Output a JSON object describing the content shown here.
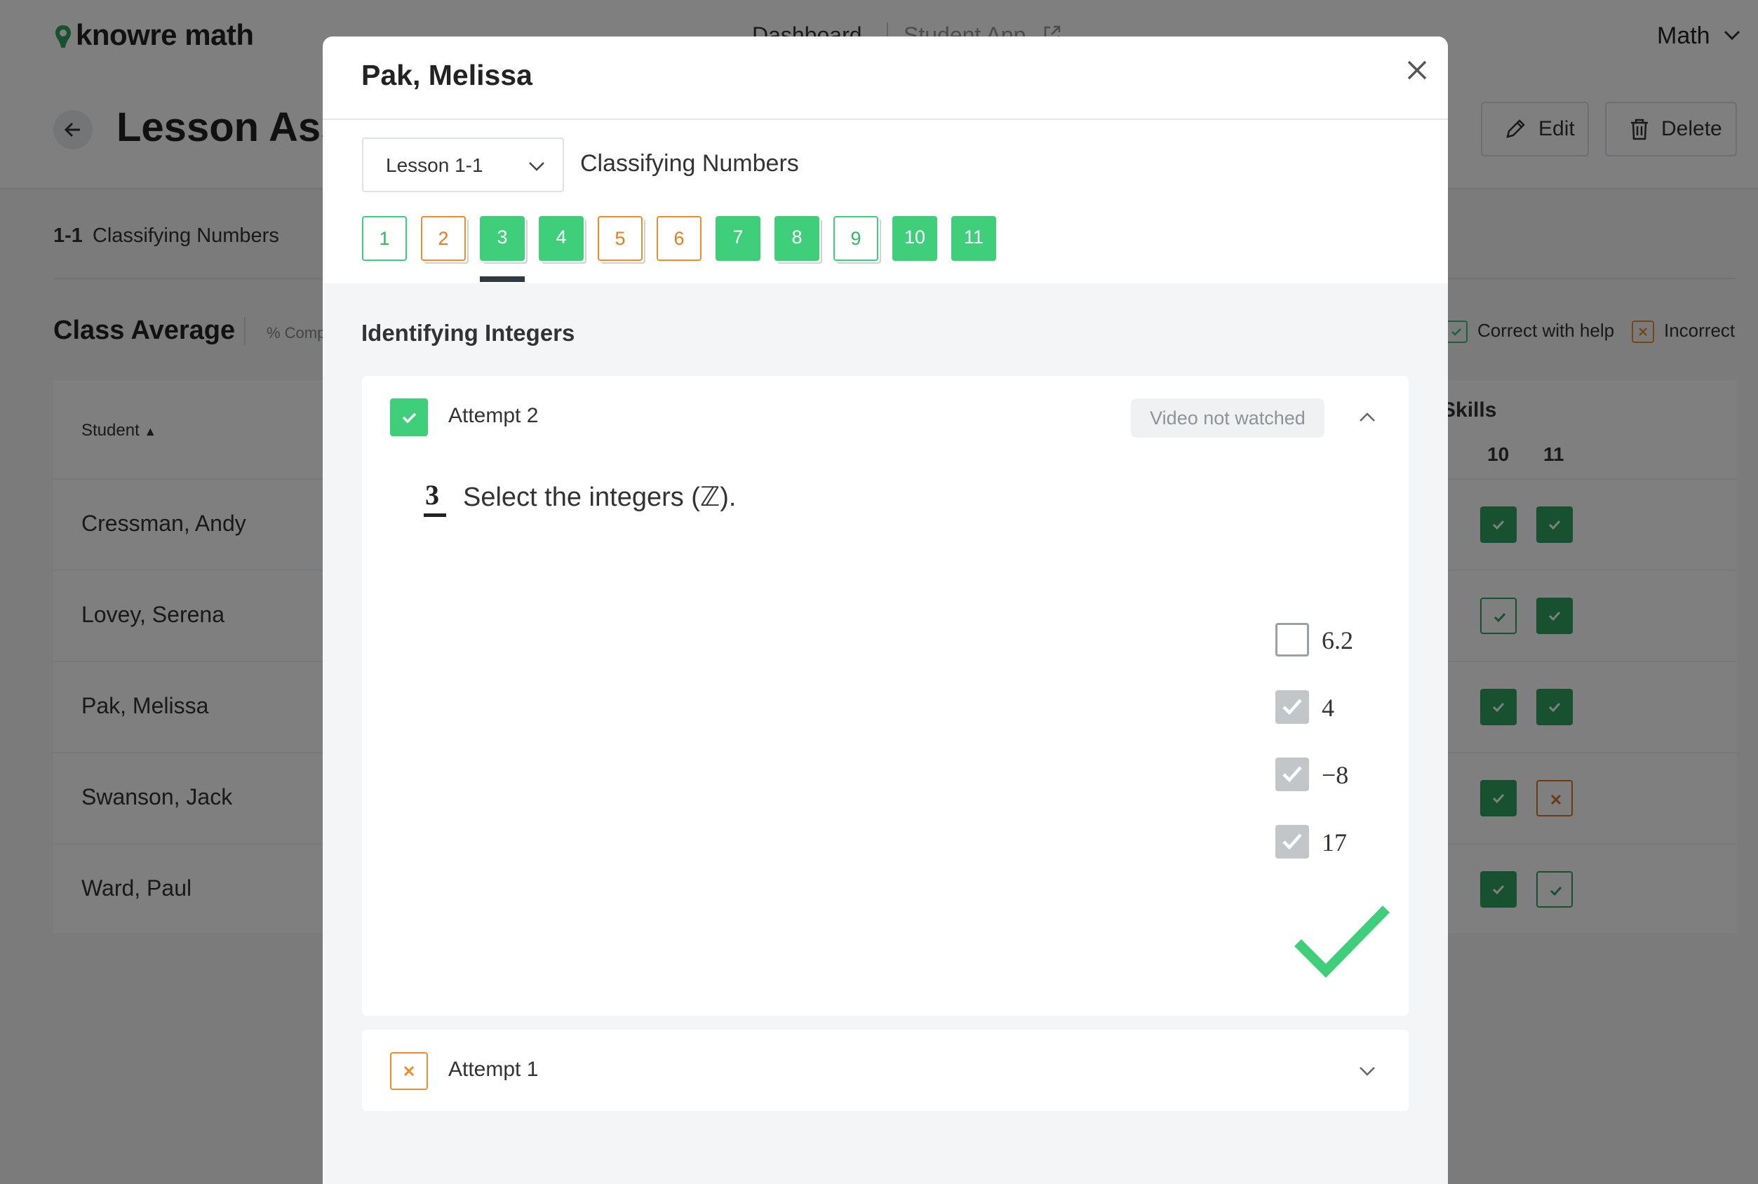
{
  "app": {
    "logo_text": "knowre math",
    "nav_dashboard": "Dashboard",
    "nav_student_app": "Student App",
    "subject": "Math"
  },
  "page": {
    "title": "Lesson Assignment",
    "edit_label": "Edit",
    "delete_label": "Delete",
    "lesson_code": "1-1",
    "lesson_name": "Classifying Numbers",
    "class_average_label": "Class Average",
    "class_average_sub": "% Complete",
    "legend_help": "Correct with help",
    "legend_incorrect": "Incorrect"
  },
  "table": {
    "student_header": "Student",
    "skills_header": "Skills",
    "col_10": "10",
    "col_11": "11",
    "rows": [
      {
        "name": "Cressman, Andy",
        "c10": "correct",
        "c11": "correct"
      },
      {
        "name": "Lovey, Serena",
        "c10": "correct-with-help",
        "c11": "correct"
      },
      {
        "name": "Pak, Melissa",
        "c10": "correct",
        "c11": "correct"
      },
      {
        "name": "Swanson, Jack",
        "c10": "correct",
        "c11": "incorrect"
      },
      {
        "name": "Ward, Paul",
        "c10": "correct",
        "c11": "correct-with-help"
      }
    ]
  },
  "modal": {
    "student_name": "Pak, Melissa",
    "lesson_select": "Lesson 1-1",
    "lesson_title": "Classifying Numbers",
    "questions": [
      {
        "label": "1",
        "status": "correct-with-help",
        "multiple": false
      },
      {
        "label": "2",
        "status": "incorrect",
        "multiple": true
      },
      {
        "label": "3",
        "status": "correct",
        "multiple": true,
        "active": true
      },
      {
        "label": "4",
        "status": "correct",
        "multiple": true
      },
      {
        "label": "5",
        "status": "incorrect",
        "multiple": true
      },
      {
        "label": "6",
        "status": "incorrect",
        "multiple": false
      },
      {
        "label": "7",
        "status": "correct",
        "multiple": false
      },
      {
        "label": "8",
        "status": "correct",
        "multiple": true
      },
      {
        "label": "9",
        "status": "correct-with-help",
        "multiple": true
      },
      {
        "label": "10",
        "status": "correct",
        "multiple": false
      },
      {
        "label": "11",
        "status": "correct",
        "multiple": false
      }
    ],
    "skill_title": "Identifying Integers",
    "attempt2": {
      "label": "Attempt 2",
      "status": "correct",
      "video_status": "Video not watched",
      "question_number": "3",
      "question_text": "Select the integers (ℤ).",
      "options": [
        {
          "value": "6.2",
          "checked": false
        },
        {
          "value": "4",
          "checked": true
        },
        {
          "value": "−8",
          "checked": true
        },
        {
          "value": "17",
          "checked": true
        }
      ]
    },
    "attempt1": {
      "label": "Attempt 1",
      "status": "incorrect"
    }
  },
  "colors": {
    "green": "#3fcf7b",
    "dark_green": "#2fa25f",
    "orange": "#f08b2c",
    "overlay": "rgba(0,0,0,0.5)"
  }
}
